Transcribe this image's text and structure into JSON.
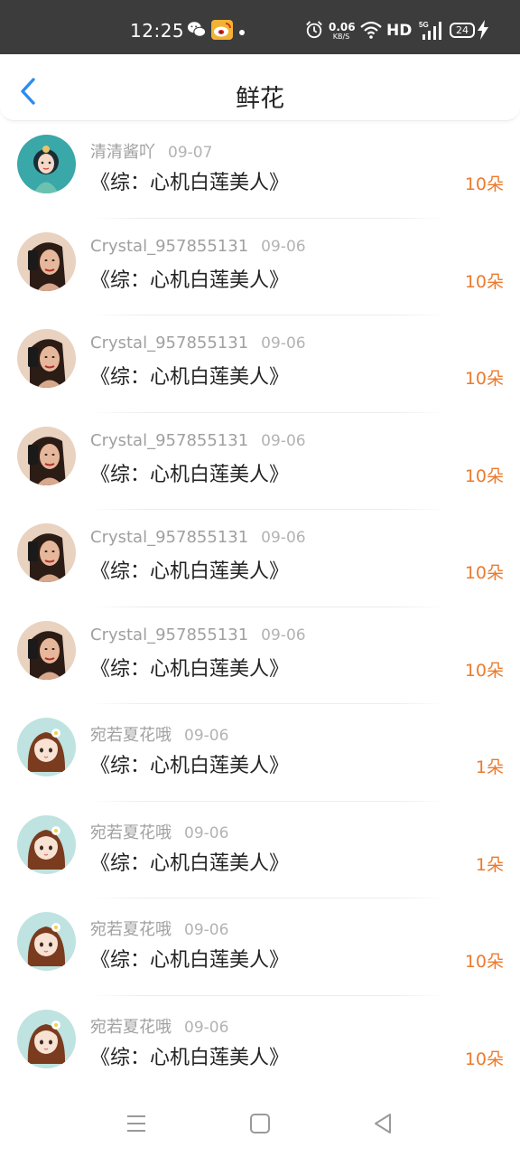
{
  "status_bar": {
    "time": "12:25",
    "net_speed": "0.06",
    "net_unit": "KB/S",
    "hd_label": "HD",
    "signal_label": "5G",
    "battery": "24",
    "icons": [
      "wechat-icon",
      "weibo-icon",
      "alarm-icon",
      "wifi-icon",
      "signal-icon",
      "battery-icon",
      "charging-icon"
    ]
  },
  "header": {
    "title": "鲜花",
    "back_icon": "chevron-left-icon"
  },
  "list": [
    {
      "user": "清清酱吖",
      "date": "09-07",
      "book": "《综：心机白莲美人》",
      "amount": "10朵",
      "avatar": "avatar-anime"
    },
    {
      "user": "Crystal_957855131",
      "date": "09-06",
      "book": "《综：心机白莲美人》",
      "amount": "10朵",
      "avatar": "avatar-photo"
    },
    {
      "user": "Crystal_957855131",
      "date": "09-06",
      "book": "《综：心机白莲美人》",
      "amount": "10朵",
      "avatar": "avatar-photo"
    },
    {
      "user": "Crystal_957855131",
      "date": "09-06",
      "book": "《综：心机白莲美人》",
      "amount": "10朵",
      "avatar": "avatar-photo"
    },
    {
      "user": "Crystal_957855131",
      "date": "09-06",
      "book": "《综：心机白莲美人》",
      "amount": "10朵",
      "avatar": "avatar-photo"
    },
    {
      "user": "Crystal_957855131",
      "date": "09-06",
      "book": "《综：心机白莲美人》",
      "amount": "10朵",
      "avatar": "avatar-photo"
    },
    {
      "user": "宛若夏花哦",
      "date": "09-06",
      "book": "《综：心机白莲美人》",
      "amount": "1朵",
      "avatar": "avatar-girl"
    },
    {
      "user": "宛若夏花哦",
      "date": "09-06",
      "book": "《综：心机白莲美人》",
      "amount": "1朵",
      "avatar": "avatar-girl"
    },
    {
      "user": "宛若夏花哦",
      "date": "09-06",
      "book": "《综：心机白莲美人》",
      "amount": "10朵",
      "avatar": "avatar-girl"
    },
    {
      "user": "宛若夏花哦",
      "date": "09-06",
      "book": "《综：心机白莲美人》",
      "amount": "10朵",
      "avatar": "avatar-girl"
    }
  ],
  "nav_bar": {
    "icons": [
      "menu-icon",
      "home-icon",
      "back-triangle-icon"
    ]
  },
  "colors": {
    "status_bar_bg": "#3c3c3c",
    "accent_blue": "#2d8cf0",
    "amount_orange": "#ec7a2c"
  }
}
